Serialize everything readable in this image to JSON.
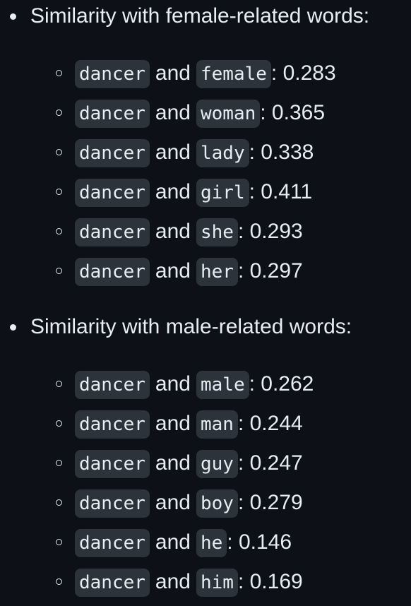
{
  "sections": [
    {
      "heading": "Similarity with female-related words:",
      "items": [
        {
          "word": "dancer",
          "connector": "and",
          "other": "female",
          "score": ": 0.283"
        },
        {
          "word": "dancer",
          "connector": "and",
          "other": "woman",
          "score": ": 0.365"
        },
        {
          "word": "dancer",
          "connector": "and",
          "other": "lady",
          "score": ": 0.338"
        },
        {
          "word": "dancer",
          "connector": "and",
          "other": "girl",
          "score": ": 0.411"
        },
        {
          "word": "dancer",
          "connector": "and",
          "other": "she",
          "score": ": 0.293"
        },
        {
          "word": "dancer",
          "connector": "and",
          "other": "her",
          "score": ": 0.297"
        }
      ]
    },
    {
      "heading": "Similarity with male-related words:",
      "items": [
        {
          "word": "dancer",
          "connector": "and",
          "other": "male",
          "score": ": 0.262"
        },
        {
          "word": "dancer",
          "connector": "and",
          "other": "man",
          "score": ": 0.244"
        },
        {
          "word": "dancer",
          "connector": "and",
          "other": "guy",
          "score": ": 0.247"
        },
        {
          "word": "dancer",
          "connector": "and",
          "other": "boy",
          "score": ": 0.279"
        },
        {
          "word": "dancer",
          "connector": "and",
          "other": "he",
          "score": ": 0.146"
        },
        {
          "word": "dancer",
          "connector": "and",
          "other": "him",
          "score": ": 0.169"
        }
      ]
    }
  ]
}
